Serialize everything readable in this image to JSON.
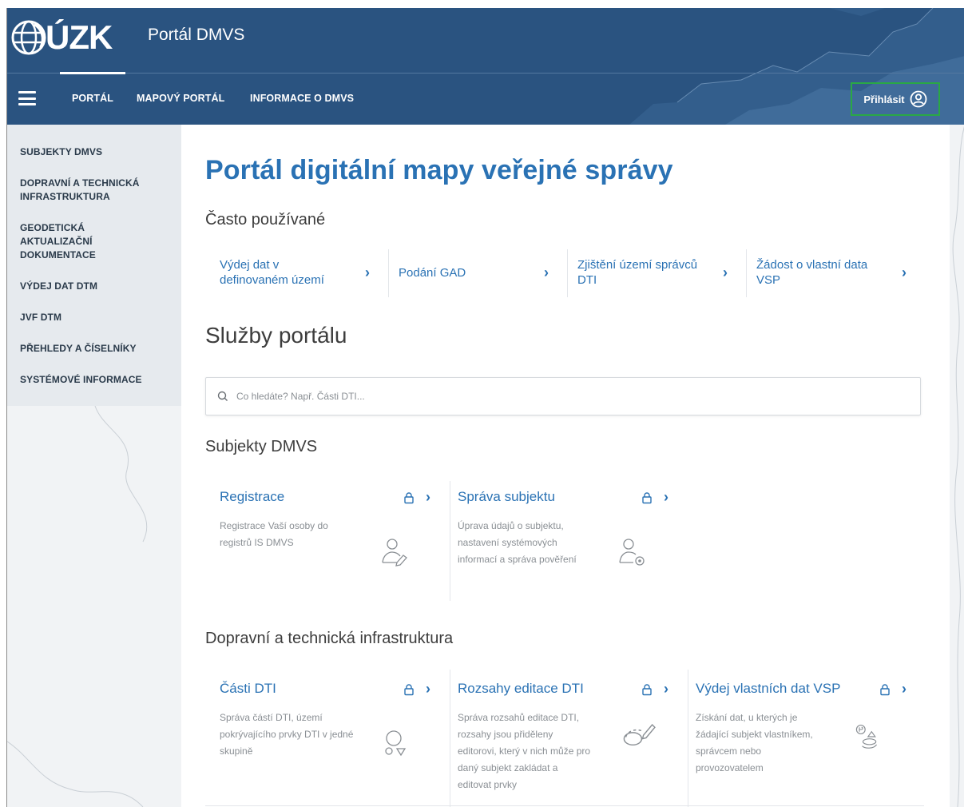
{
  "header": {
    "brand": "ÚZK",
    "app_title": "Portál DMVS",
    "nav": [
      "PORTÁL",
      "MAPOVÝ PORTÁL",
      "INFORMACE O DMVS"
    ],
    "login_label": "Přihlásit",
    "icons": {
      "menu": "hamburger-icon",
      "login": "user-circle-icon",
      "logo": "globe-logo-icon"
    }
  },
  "sidebar": {
    "items": [
      "SUBJEKTY DMVS",
      "DOPRAVNÍ A TECHNICKÁ INFRASTRUKTURA",
      "GEODETICKÁ AKTUALIZAČNÍ DOKUMENTACE",
      "VÝDEJ DAT DTM",
      "JVF DTM",
      "PŘEHLEDY A ČÍSELNÍKY",
      "SYSTÉMOVÉ INFORMACE"
    ]
  },
  "main": {
    "title": "Portál digitální mapy veřejné správy",
    "often_heading": "Často používané",
    "quick_links": [
      "Výdej dat v definovaném území",
      "Podání GAD",
      "Zjištění území správců DTI",
      "Žádost o vlastní data VSP"
    ],
    "services_heading": "Služby portálu",
    "search_placeholder": "Co hledáte? Např. Části DTI...",
    "subjects_heading": "Subjekty DMVS",
    "subject_cards": [
      {
        "title": "Registrace",
        "desc": "Registrace Vaší osoby do registrů IS DMVS",
        "icon": "user-register-icon"
      },
      {
        "title": "Správa subjektu",
        "desc": "Úprava údajů o subjektu, nastavení systémových informací a správa pověření",
        "icon": "user-settings-icon"
      }
    ],
    "infra_heading": "Dopravní a technická infrastruktura",
    "infra_cards": [
      {
        "title": "Části DTI",
        "desc": "Správa částí DTI, území pokrývajícího prvky DTI v jedné skupině",
        "icon": "dti-parts-icon"
      },
      {
        "title": "Rozsahy editace DTI",
        "desc": "Správa rozsahů editace DTI, rozsahy jsou přiděleny editorovi, který v nich může pro daný subjekt zakládat a editovat prvky",
        "icon": "edit-range-icon"
      },
      {
        "title": "Výdej vlastních dat VSP",
        "desc": "Získání dat, u kterých je žádající subjekt vlastníkem, správcem nebo provozovatelem",
        "icon": "data-export-icon"
      }
    ]
  },
  "colors": {
    "header_bg": "#2a5380",
    "accent": "#2a72b4",
    "highlight_box": "#2aa845",
    "sidebar_bg": "#e6eaee"
  }
}
